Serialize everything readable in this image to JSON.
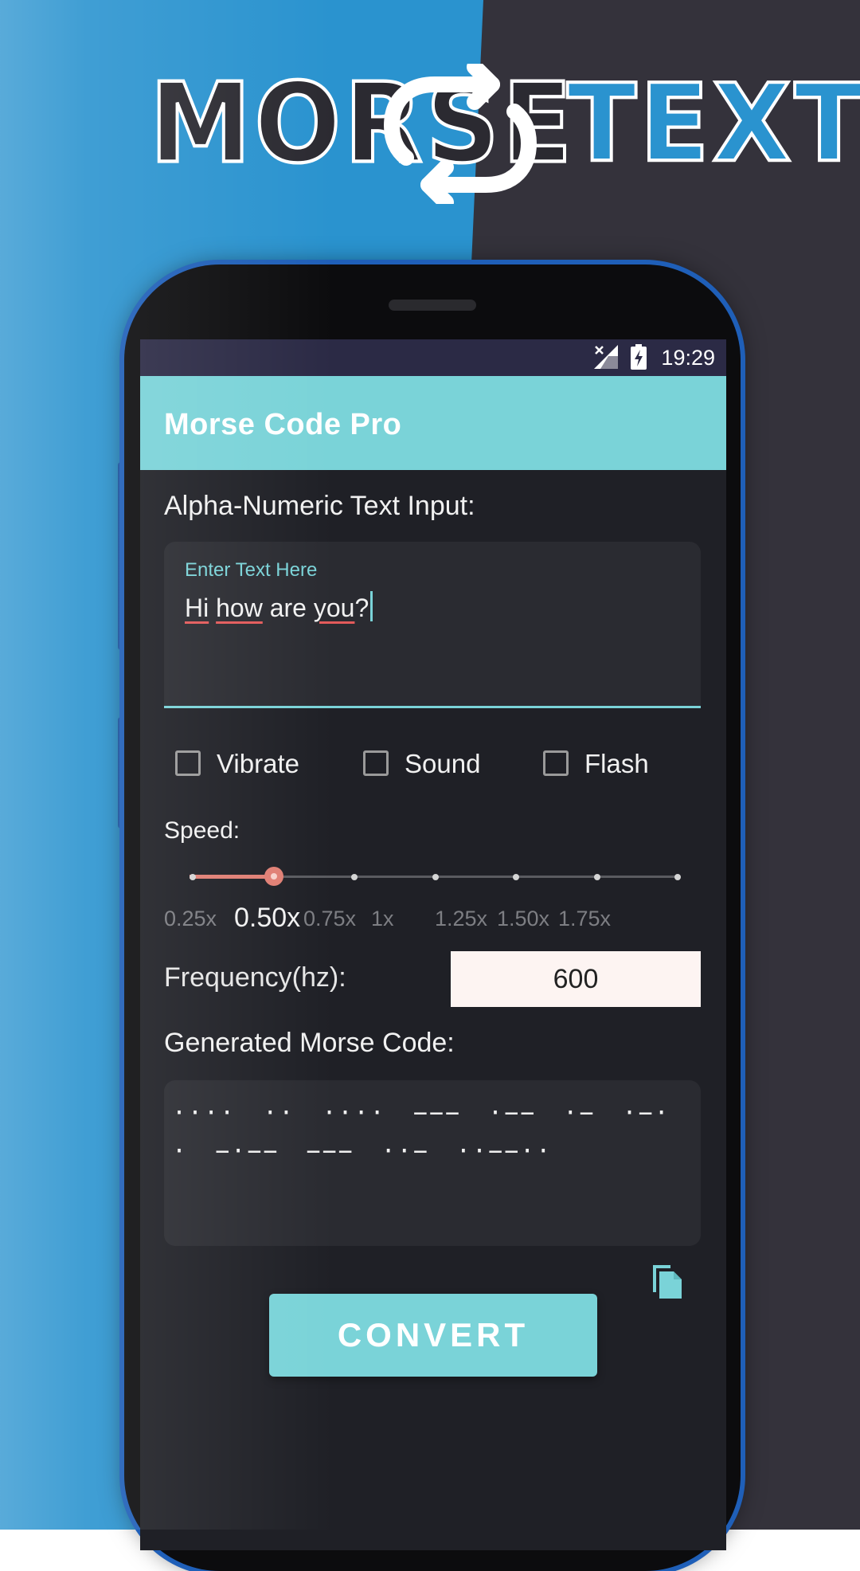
{
  "banner": {
    "left_word": "MORSE",
    "right_word": "TEXT",
    "swap_icon": "swap-arrows-icon"
  },
  "status_bar": {
    "time": "19:29"
  },
  "app_bar": {
    "title": "Morse Code Pro"
  },
  "text_input": {
    "label": "Alpha-Numeric Text Input:",
    "hint": "Enter Text Here",
    "value_parts": [
      "Hi",
      " ",
      "how",
      " are ",
      "you",
      "?"
    ]
  },
  "options": [
    {
      "label": "Vibrate",
      "checked": false
    },
    {
      "label": "Sound",
      "checked": false
    },
    {
      "label": "Flash",
      "checked": false
    }
  ],
  "speed": {
    "label": "Speed:",
    "ticks": [
      "0.25x",
      "0.50x",
      "0.75x",
      "1x",
      "1.25x",
      "1.50x",
      "1.75x"
    ],
    "selected": "0.50x"
  },
  "frequency": {
    "label": "Frequency(hz):",
    "value": "600"
  },
  "morse_output": {
    "label": "Generated Morse Code:",
    "text": "···· ··    ···· −−− ·−−    ·− ·−· ·    −·−− −−− ··− ··−−··"
  },
  "convert_button": {
    "label": "CONVERT"
  },
  "colors": {
    "accent": "#7ad3d8",
    "slider": "#e07f74",
    "blue_bg": "#2a93cf",
    "dark_bg": "#34323b"
  }
}
